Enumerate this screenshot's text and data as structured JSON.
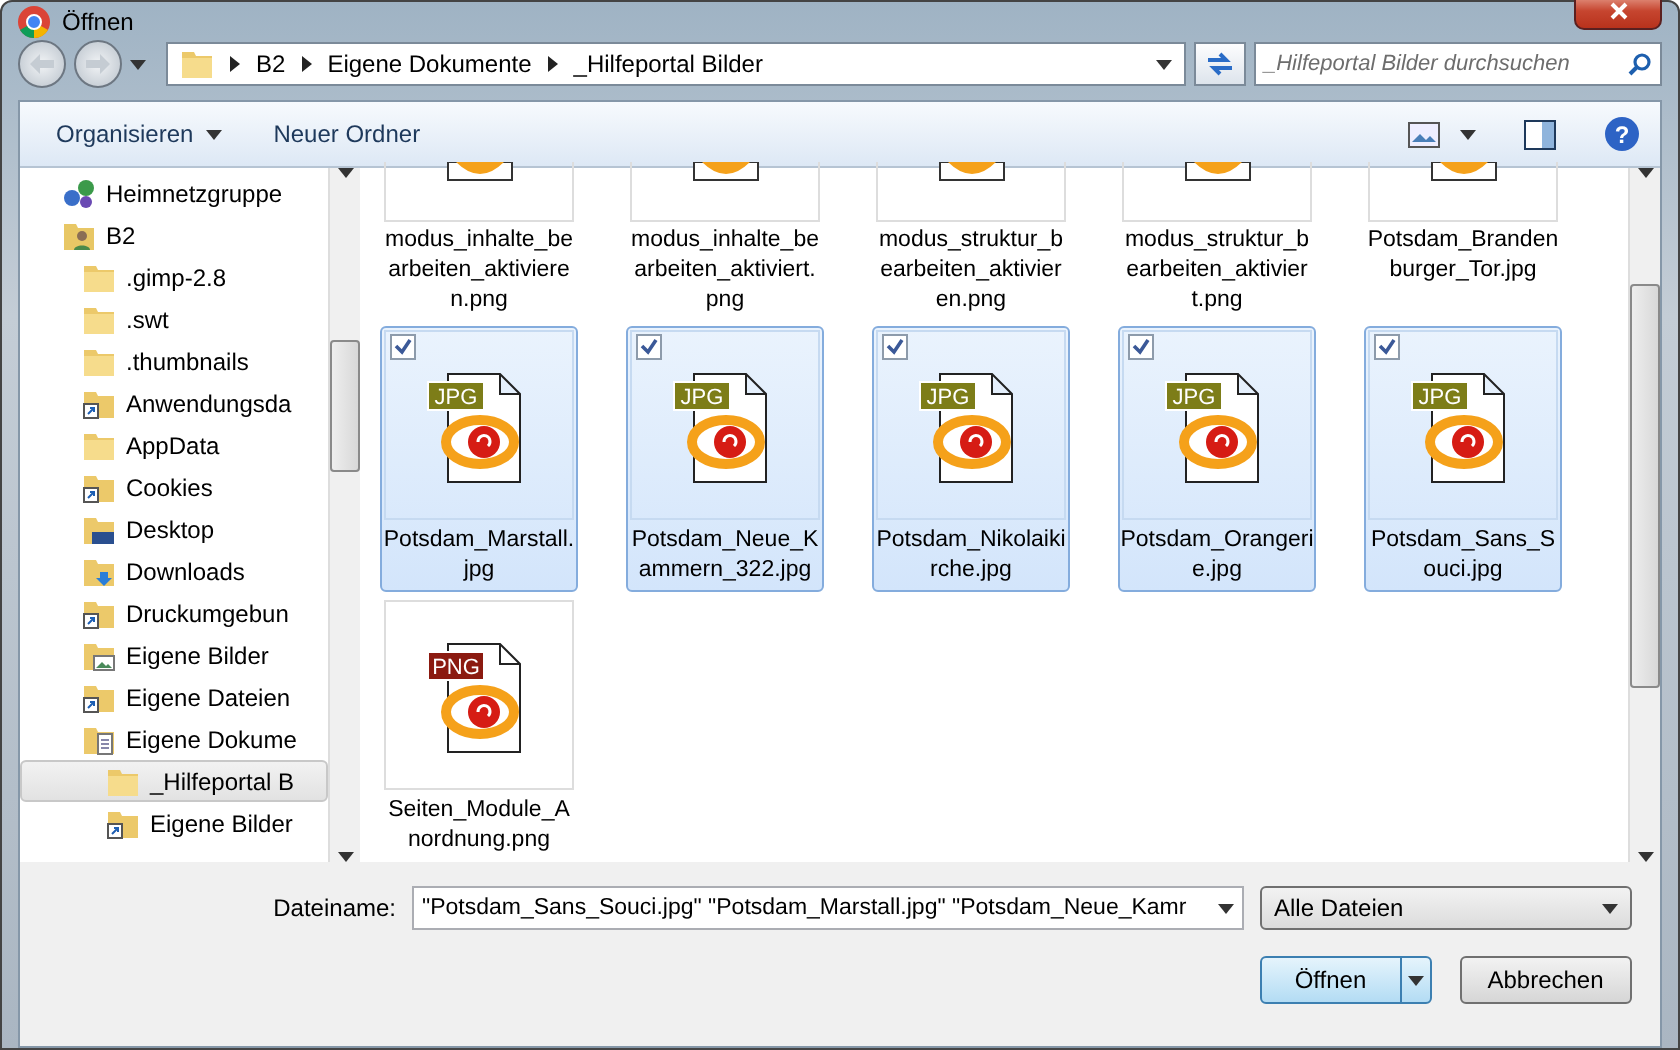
{
  "window": {
    "title": "Öffnen"
  },
  "address": {
    "segments": [
      "B2",
      "Eigene Dokumente",
      "_Hilfeportal Bilder"
    ]
  },
  "search": {
    "placeholder": "_Hilfeportal Bilder durchsuchen"
  },
  "toolbar": {
    "buttons": [
      "Organisieren",
      "Neuer Ordner"
    ],
    "help": "?"
  },
  "sidebar": {
    "items": [
      {
        "label": "Heimnetzgruppe",
        "kind": "network",
        "selected": false
      },
      {
        "label": "B2",
        "kind": "user",
        "selected": false,
        "children": [
          {
            "label": ".gimp-2.8",
            "kind": "folder",
            "selected": false
          },
          {
            "label": ".swt",
            "kind": "folder",
            "selected": false
          },
          {
            "label": ".thumbnails",
            "kind": "folder",
            "selected": false
          },
          {
            "label": "Anwendungsda",
            "kind": "link",
            "selected": false
          },
          {
            "label": "AppData",
            "kind": "folder",
            "selected": false
          },
          {
            "label": "Cookies",
            "kind": "link",
            "selected": false
          },
          {
            "label": "Desktop",
            "kind": "desktop",
            "selected": false
          },
          {
            "label": "Downloads",
            "kind": "download",
            "selected": false
          },
          {
            "label": "Druckumgebun",
            "kind": "link",
            "selected": false
          },
          {
            "label": "Eigene Bilder",
            "kind": "pictures",
            "selected": false
          },
          {
            "label": "Eigene Dateien",
            "kind": "link",
            "selected": false
          },
          {
            "label": "Eigene Dokume",
            "kind": "documents",
            "selected": false,
            "children": [
              {
                "label": "_Hilfeportal B",
                "kind": "folder",
                "selected": true
              },
              {
                "label": "Eigene Bilder",
                "kind": "link",
                "selected": false
              }
            ]
          }
        ]
      }
    ]
  },
  "files": [
    {
      "name": "modus_inhalte_bearbeiten_aktivieren.png",
      "kind": "partial",
      "selected": false,
      "checked": false
    },
    {
      "name": "modus_inhalte_bearbeiten_aktiviert.png",
      "kind": "partial",
      "selected": false,
      "checked": false
    },
    {
      "name": "modus_struktur_bearbeiten_aktivieren.png",
      "kind": "partial",
      "selected": false,
      "checked": false
    },
    {
      "name": "modus_struktur_bearbeiten_aktiviert.png",
      "kind": "partial",
      "selected": false,
      "checked": false
    },
    {
      "name": "Potsdam_Brandenburger_Tor.jpg",
      "kind": "partial",
      "selected": false,
      "checked": false
    },
    {
      "name": "Potsdam_Marstall.jpg",
      "kind": "full",
      "badge": "JPG",
      "selected": true,
      "checked": true
    },
    {
      "name": "Potsdam_Neue_Kammern_322.jpg",
      "kind": "full",
      "badge": "JPG",
      "selected": true,
      "checked": true
    },
    {
      "name": "Potsdam_Nikolaikirche.jpg",
      "kind": "full",
      "badge": "JPG",
      "selected": true,
      "checked": true
    },
    {
      "name": "Potsdam_Orangerie.jpg",
      "kind": "full",
      "badge": "JPG",
      "selected": true,
      "checked": true
    },
    {
      "name": "Potsdam_Sans_Souci.jpg",
      "kind": "full",
      "badge": "JPG",
      "selected": true,
      "checked": true
    },
    {
      "name": "Seiten_Module_Anordnung.png",
      "kind": "full",
      "badge": "PNG",
      "selected": false,
      "checked": false
    }
  ],
  "filename": {
    "label": "Dateiname:",
    "value": "\"Potsdam_Sans_Souci.jpg\" \"Potsdam_Marstall.jpg\" \"Potsdam_Neue_Kamr"
  },
  "filter": {
    "value": "Alle Dateien"
  },
  "buttons": [
    {
      "label": "Öffnen",
      "kind": "split"
    },
    {
      "label": "Abbrechen",
      "kind": "plain"
    }
  ]
}
